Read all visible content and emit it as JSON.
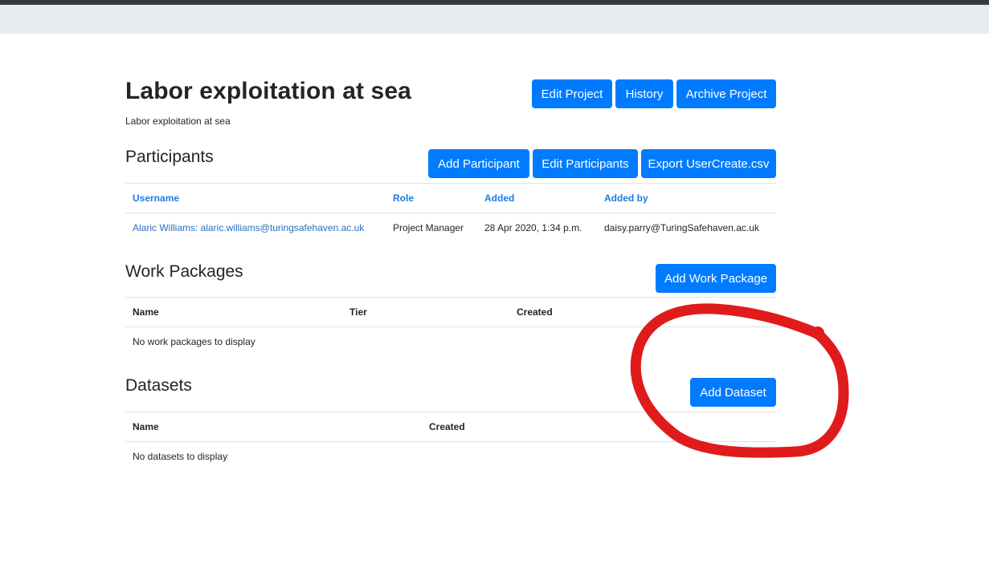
{
  "project": {
    "title": "Labor exploitation at sea",
    "description": "Labor exploitation at sea",
    "buttons": {
      "edit": "Edit Project",
      "history": "History",
      "archive": "Archive Project"
    }
  },
  "participants": {
    "title": "Participants",
    "buttons": {
      "add": "Add Participant",
      "edit": "Edit Participants",
      "export": "Export UserCreate.csv"
    },
    "columns": [
      "Username",
      "Role",
      "Added",
      "Added by"
    ],
    "rows": [
      {
        "username": "Alaric Williams: alaric.williams@turingsafehaven.ac.uk",
        "role": "Project Manager",
        "added": "28 Apr 2020, 1:34 p.m.",
        "added_by": "daisy.parry@TuringSafehaven.ac.uk"
      }
    ]
  },
  "work_packages": {
    "title": "Work Packages",
    "add_button": "Add Work Package",
    "columns": [
      "Name",
      "Tier",
      "Created"
    ],
    "empty": "No work packages to display"
  },
  "datasets": {
    "title": "Datasets",
    "add_button": "Add Dataset",
    "columns": [
      "Name",
      "Created"
    ],
    "empty": "No datasets to display"
  },
  "colors": {
    "primary": "#007bff",
    "link": "#1f7ce0",
    "navbar": "#343a40",
    "subbar": "#e9ecef",
    "annotation": "#e01b1b"
  }
}
